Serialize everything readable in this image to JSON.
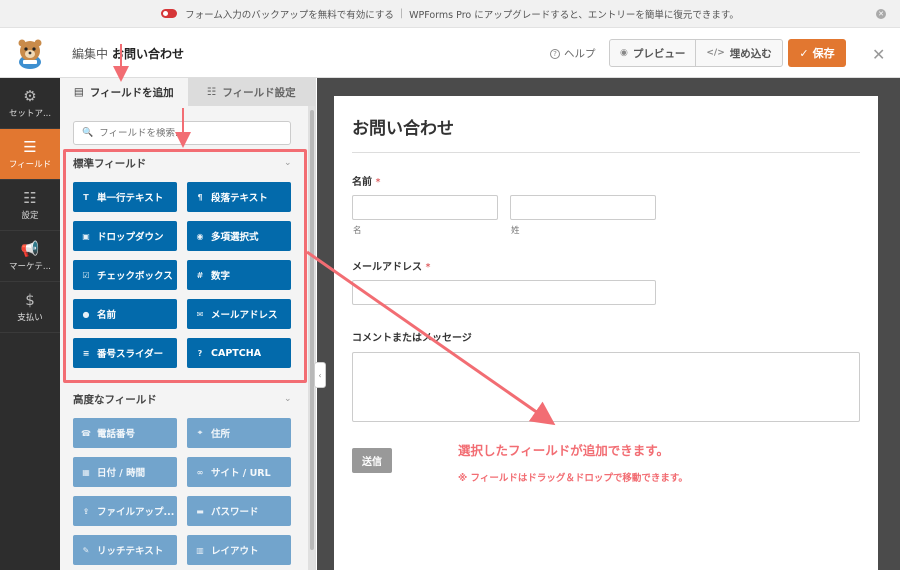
{
  "notice": {
    "text": "フォーム入力のバックアップを無料で有効にする",
    "separator": "|",
    "upgrade": "WPForms Pro にアップグレードすると、エントリーを簡単に復元できます。",
    "close_icon": "close-circle-icon"
  },
  "header": {
    "editing_label": "編集中",
    "form_name": "お問い合わせ",
    "help": "ヘルプ",
    "preview": "プレビュー",
    "embed": "埋め込む",
    "save": "保存",
    "close_icon": "close-icon"
  },
  "sidebar": {
    "items": [
      {
        "label": "セットア...",
        "icon": "gear-icon",
        "active": false
      },
      {
        "label": "フィールド",
        "icon": "fields-list-icon",
        "active": true
      },
      {
        "label": "設定",
        "icon": "sliders-icon",
        "active": false
      },
      {
        "label": "マーケテ...",
        "icon": "megaphone-icon",
        "active": false
      },
      {
        "label": "支払い",
        "icon": "dollar-icon",
        "active": false
      }
    ]
  },
  "panel": {
    "tabs": [
      {
        "label": "フィールドを追加",
        "icon": "list-icon",
        "active": true
      },
      {
        "label": "フィールド設定",
        "icon": "sliders-icon",
        "active": false
      }
    ],
    "search_placeholder": "フィールドを検索...",
    "standard": {
      "title": "標準フィールド",
      "fields": [
        {
          "label": "単一行テキスト",
          "icon": "T"
        },
        {
          "label": "段落テキスト",
          "icon": "¶"
        },
        {
          "label": "ドロップダウン",
          "icon": "▣"
        },
        {
          "label": "多項選択式",
          "icon": "◉"
        },
        {
          "label": "チェックボックス",
          "icon": "☑"
        },
        {
          "label": "数字",
          "icon": "#"
        },
        {
          "label": "名前",
          "icon": "●"
        },
        {
          "label": "メールアドレス",
          "icon": "✉"
        },
        {
          "label": "番号スライダー",
          "icon": "≡"
        },
        {
          "label": "CAPTCHA",
          "icon": "?"
        }
      ]
    },
    "advanced": {
      "title": "高度なフィールド",
      "fields": [
        {
          "label": "電話番号",
          "icon": "☎"
        },
        {
          "label": "住所",
          "icon": "⌖"
        },
        {
          "label": "日付 / 時間",
          "icon": "▦"
        },
        {
          "label": "サイト / URL",
          "icon": "∞"
        },
        {
          "label": "ファイルアップ...",
          "icon": "⇪"
        },
        {
          "label": "パスワード",
          "icon": "▬"
        },
        {
          "label": "リッチテキスト",
          "icon": "✎"
        },
        {
          "label": "レイアウト",
          "icon": "▥"
        }
      ]
    }
  },
  "form": {
    "title": "お問い合わせ",
    "name_label": "名前",
    "required_mark": "*",
    "first_sub": "名",
    "last_sub": "姓",
    "email_label": "メールアドレス",
    "comment_label": "コメントまたはメッセージ",
    "submit": "送信"
  },
  "annotation": {
    "main": "選択したフィールドが追加できます。",
    "note": "※ フィールドはドラッグ＆ドロップで移動できます。"
  },
  "colors": {
    "accent": "#e27730",
    "field_button": "#036aab",
    "advanced_button": "#72a4cc",
    "annotation": "#f26d73",
    "sidebar": "#2d2d2d"
  }
}
